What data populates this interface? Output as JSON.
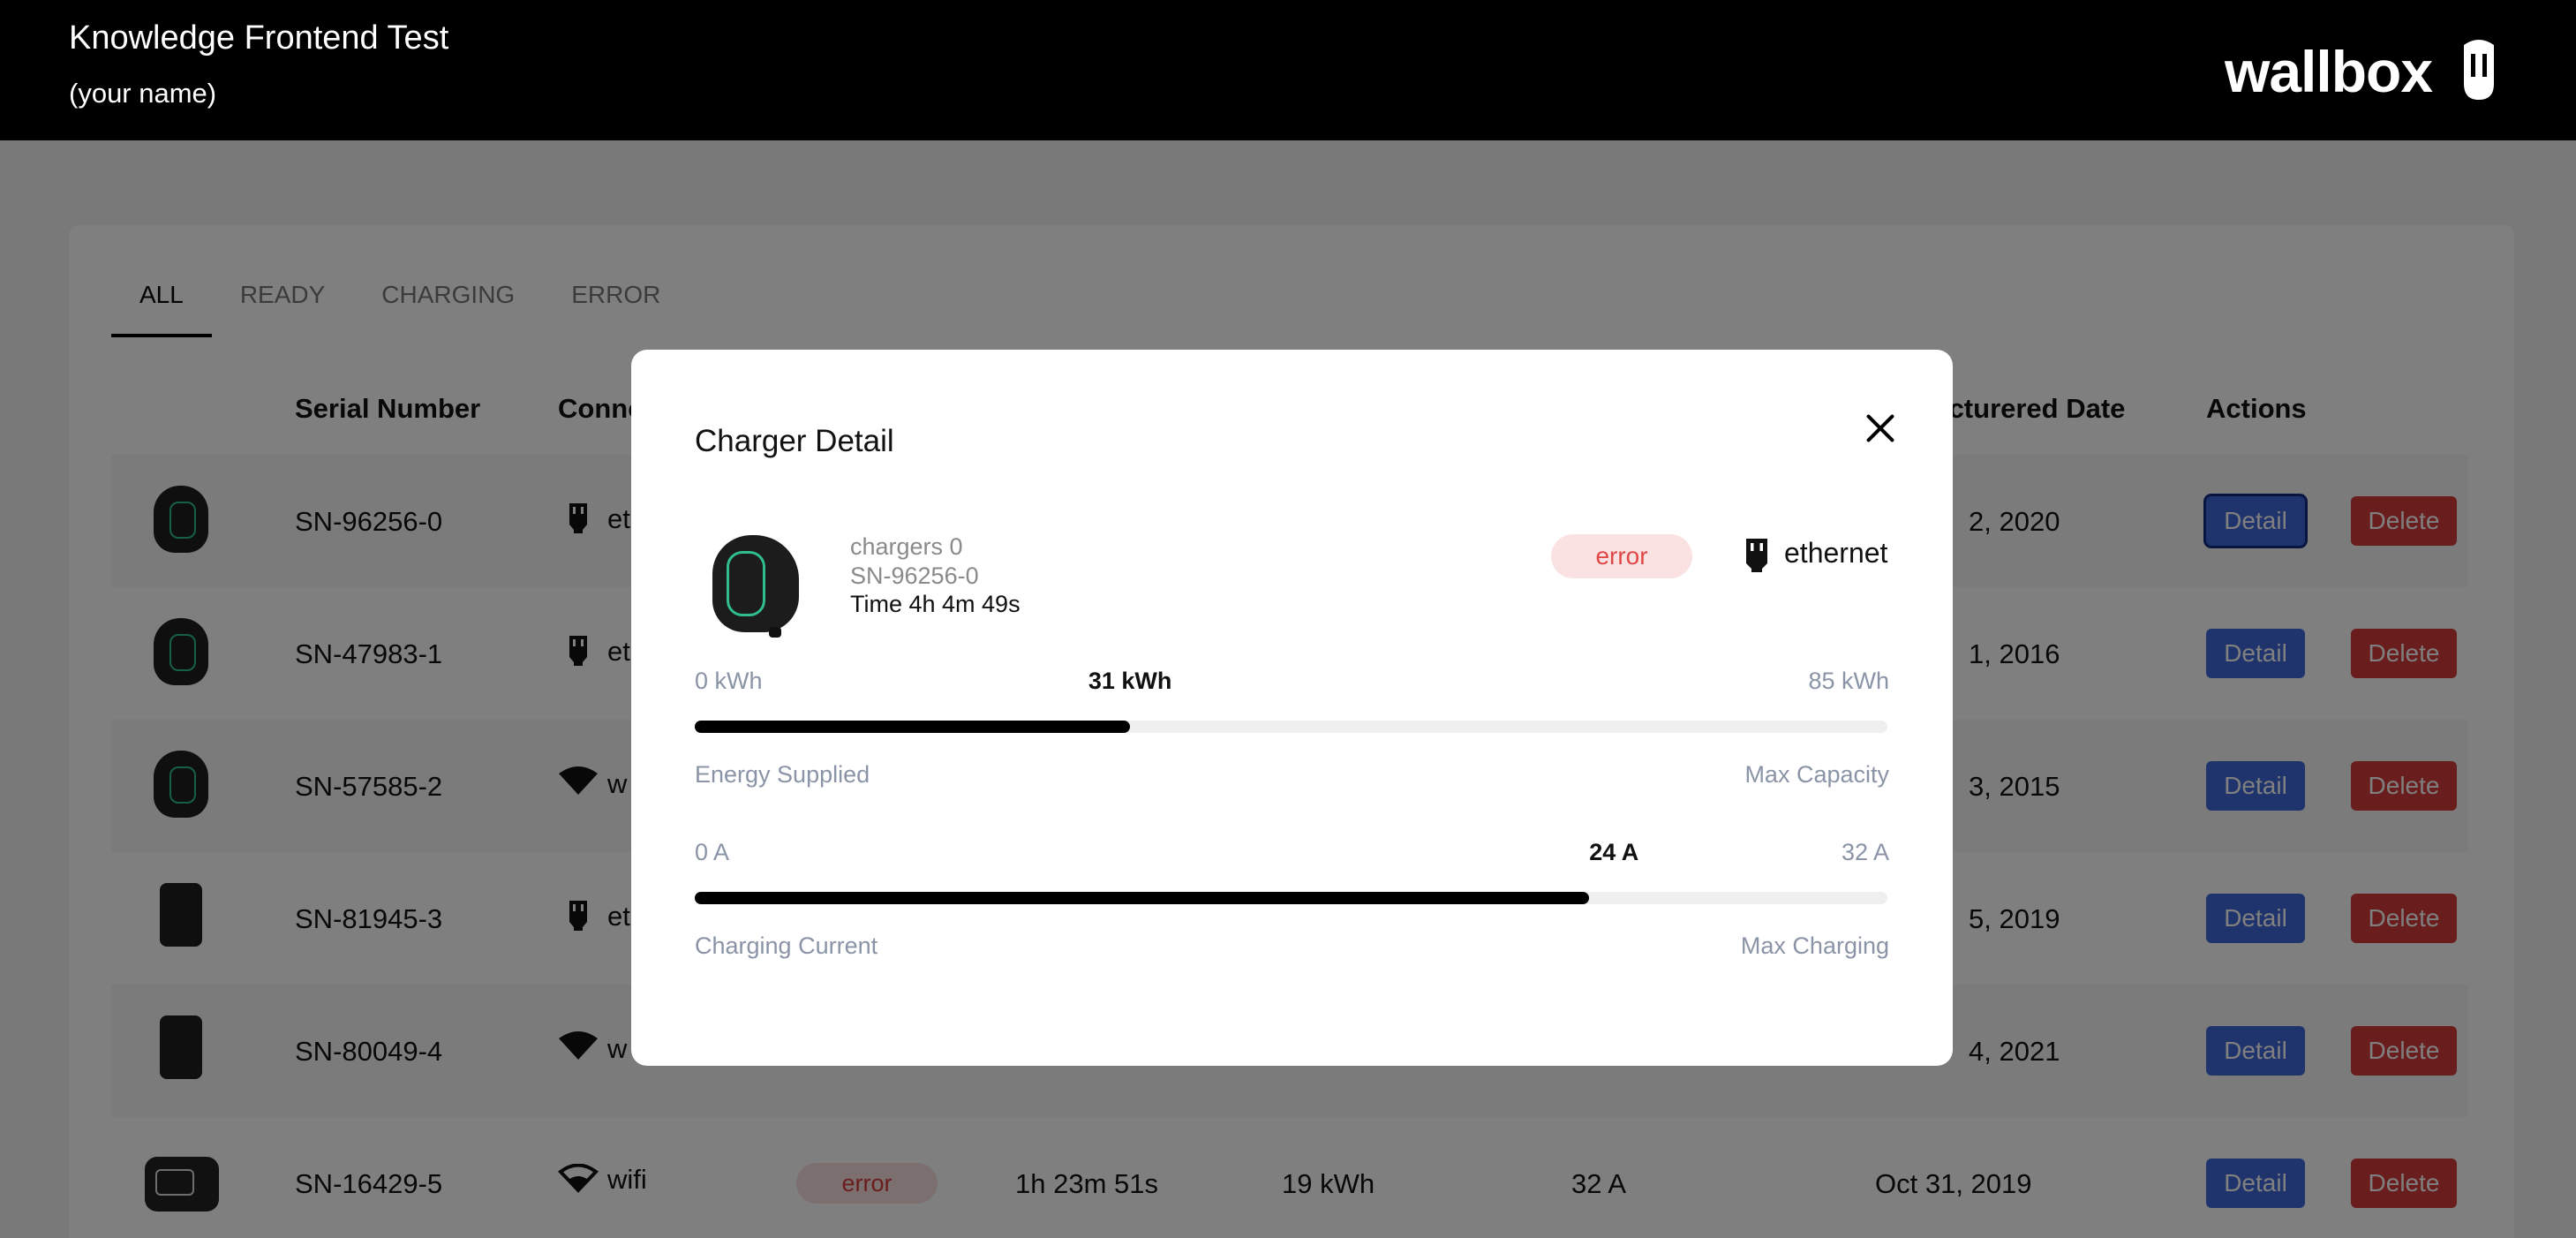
{
  "header": {
    "title": "Knowledge Frontend Test",
    "subtitle": "(your name)",
    "logo_text": "wallbox"
  },
  "tabs": [
    {
      "label": "ALL",
      "active": true
    },
    {
      "label": "READY",
      "active": false
    },
    {
      "label": "CHARGING",
      "active": false
    },
    {
      "label": "ERROR",
      "active": false
    }
  ],
  "table": {
    "columns": {
      "serial": "Serial Number",
      "connection": "Conne",
      "manufactured": "facturered Date",
      "actions": "Actions"
    },
    "rows": [
      {
        "serial": "SN-96256-0",
        "conn_icon": "ethernet-icon",
        "conn": "et",
        "date": "2, 2020",
        "detail_focused": true
      },
      {
        "serial": "SN-47983-1",
        "conn_icon": "ethernet-icon",
        "conn": "et",
        "date": "1, 2016"
      },
      {
        "serial": "SN-57585-2",
        "conn_icon": "wifi-icon",
        "conn": "w",
        "date": "3, 2015"
      },
      {
        "serial": "SN-81945-3",
        "conn_icon": "ethernet-icon",
        "conn": "et",
        "date": "5, 2019"
      },
      {
        "serial": "SN-80049-4",
        "conn_icon": "wifi-icon",
        "conn": "w",
        "date": "4, 2021"
      },
      {
        "serial": "SN-16429-5",
        "conn_icon": "wifi-icon",
        "conn": "wifi",
        "status": "error",
        "time": "1h 23m 51s",
        "energy": "19 kWh",
        "current": "32 A",
        "date": "Oct 31, 2019"
      }
    ],
    "detail_label": "Detail",
    "delete_label": "Delete"
  },
  "modal": {
    "title": "Charger Detail",
    "charger_name": "chargers 0",
    "serial": "SN-96256-0",
    "time": "Time 4h 4m 49s",
    "status": "error",
    "connection": "ethernet",
    "connection_icon": "ethernet-icon",
    "energy": {
      "min": "0 kWh",
      "current": "31 kWh",
      "max": "85 kWh",
      "fill_fraction": 0.365,
      "left_label": "Energy Supplied",
      "right_label": "Max Capacity"
    },
    "charging_current": {
      "min": "0 A",
      "current": "24 A",
      "max": "32 A",
      "fill_fraction": 0.75,
      "left_label": "Charging Current",
      "right_label": "Max Charging"
    }
  },
  "colors": {
    "primary": "#3f68d8",
    "danger": "#d43a3a",
    "error_bg": "#fbe2e2",
    "header_bg": "#000000"
  }
}
